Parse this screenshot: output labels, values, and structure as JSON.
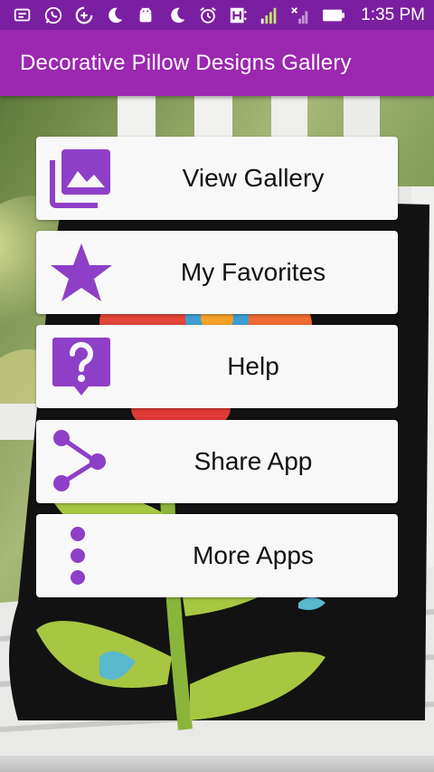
{
  "status_bar": {
    "time": "1:35 PM",
    "icons": [
      "notification-icon",
      "whatsapp-icon",
      "data-saver-icon",
      "moon-icon",
      "android-icon",
      "do-not-disturb-icon",
      "alarm-icon",
      "hd-signal-icon",
      "signal-icon",
      "no-signal-icon",
      "battery-icon"
    ]
  },
  "app_bar": {
    "title": "Decorative Pillow Designs Gallery"
  },
  "menu": [
    {
      "label": "View Gallery",
      "icon": "gallery-icon"
    },
    {
      "label": "My Favorites",
      "icon": "star-icon"
    },
    {
      "label": "Help",
      "icon": "help-icon"
    },
    {
      "label": "Share App",
      "icon": "share-icon"
    },
    {
      "label": "More Apps",
      "icon": "more-vert-icon"
    }
  ],
  "colors": {
    "status_bar": "#7b1fa2",
    "app_bar": "#9c27b0",
    "icon_accent": "#8e3fc7",
    "button_bg": "#f8f8f8"
  }
}
